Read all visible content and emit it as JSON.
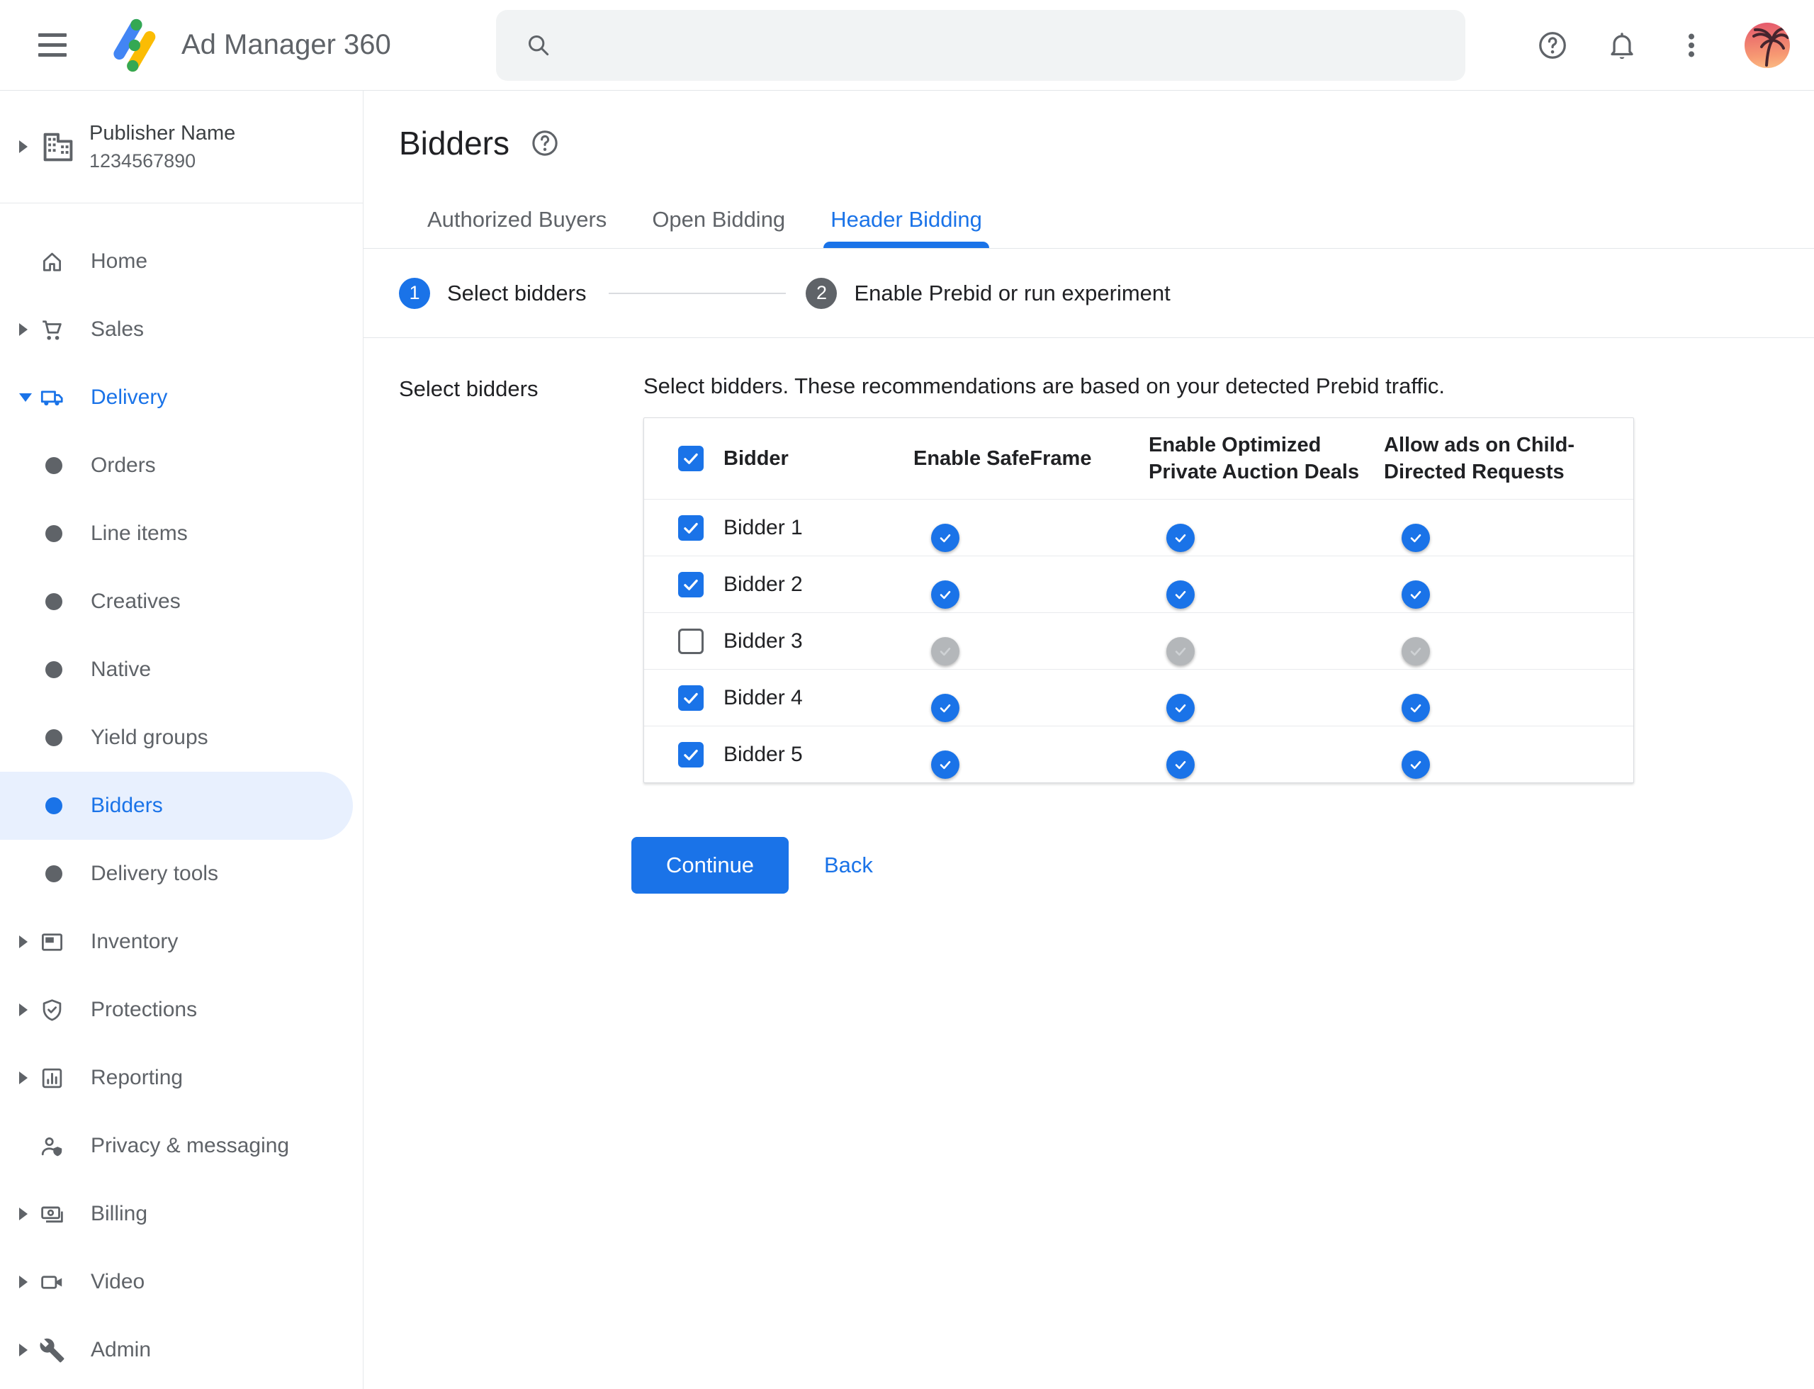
{
  "topbar": {
    "app_title": "Ad Manager 360",
    "search": {
      "value": "",
      "placeholder": ""
    }
  },
  "sidebar": {
    "publisher": {
      "name": "Publisher Name",
      "network_code": "1234567890"
    },
    "items": [
      {
        "label": "Home"
      },
      {
        "label": "Sales"
      },
      {
        "label": "Delivery",
        "expanded": true,
        "active": true
      },
      {
        "label": "Orders"
      },
      {
        "label": "Line items"
      },
      {
        "label": "Creatives"
      },
      {
        "label": "Native"
      },
      {
        "label": "Yield groups"
      },
      {
        "label": "Bidders",
        "selected": true
      },
      {
        "label": "Delivery tools"
      },
      {
        "label": "Inventory"
      },
      {
        "label": "Protections"
      },
      {
        "label": "Reporting"
      },
      {
        "label": "Privacy & messaging"
      },
      {
        "label": "Billing"
      },
      {
        "label": "Video"
      },
      {
        "label": "Admin"
      }
    ]
  },
  "page": {
    "title": "Bidders",
    "tabs": [
      {
        "label": "Authorized Buyers",
        "active": false
      },
      {
        "label": "Open Bidding",
        "active": false
      },
      {
        "label": "Header Bidding",
        "active": true
      }
    ],
    "stepper": [
      {
        "number": "1",
        "label": "Select bidders",
        "active": true
      },
      {
        "number": "2",
        "label": "Enable Prebid or run experiment",
        "active": false
      }
    ]
  },
  "section": {
    "label": "Select bidders",
    "description": "Select bidders. These recommendations are based on your detected Prebid traffic."
  },
  "table": {
    "header": {
      "bidder": "Bidder",
      "safeframe": "Enable SafeFrame",
      "optimized": [
        "Enable Optimized",
        "Private Auction Deals"
      ],
      "child_directed": [
        "Allow ads on Child-",
        "Directed Requests"
      ],
      "select_all_checked": true
    },
    "rows": [
      {
        "name": "Bidder 1",
        "selected": true,
        "safeframe_on": true,
        "optimized_on": true,
        "child_directed_on": true
      },
      {
        "name": "Bidder 2",
        "selected": true,
        "safeframe_on": true,
        "optimized_on": true,
        "child_directed_on": true
      },
      {
        "name": "Bidder 3",
        "selected": false,
        "safeframe_on": false,
        "optimized_on": false,
        "child_directed_on": false
      },
      {
        "name": "Bidder 4",
        "selected": true,
        "safeframe_on": true,
        "optimized_on": true,
        "child_directed_on": true
      },
      {
        "name": "Bidder 5",
        "selected": true,
        "safeframe_on": true,
        "optimized_on": true,
        "child_directed_on": true
      }
    ]
  },
  "actions": {
    "continue_label": "Continue",
    "back_label": "Back"
  },
  "colors": {
    "accent": "#1a73e8",
    "selected_item_bg": "#e8f0fe",
    "toggle_track_on": "#8ab4f8",
    "toggle_thumb_on": "#1a73e8",
    "toggle_track_off": "#ebedef",
    "toggle_thumb_off": "#b4b7ba",
    "text_primary": "#202124",
    "text_secondary": "#5f6368",
    "logo_blue": "#4285f4",
    "logo_yellow": "#fbbc04",
    "logo_green": "#34a853"
  },
  "icons": {
    "hamburger-menu": "≡",
    "search": "⌕",
    "help": "?",
    "notifications": "bell",
    "more-vertical": "⋮",
    "expand-arrow": "▸",
    "collapse-arrow": "▾",
    "bullet": "•",
    "check": "✓"
  }
}
